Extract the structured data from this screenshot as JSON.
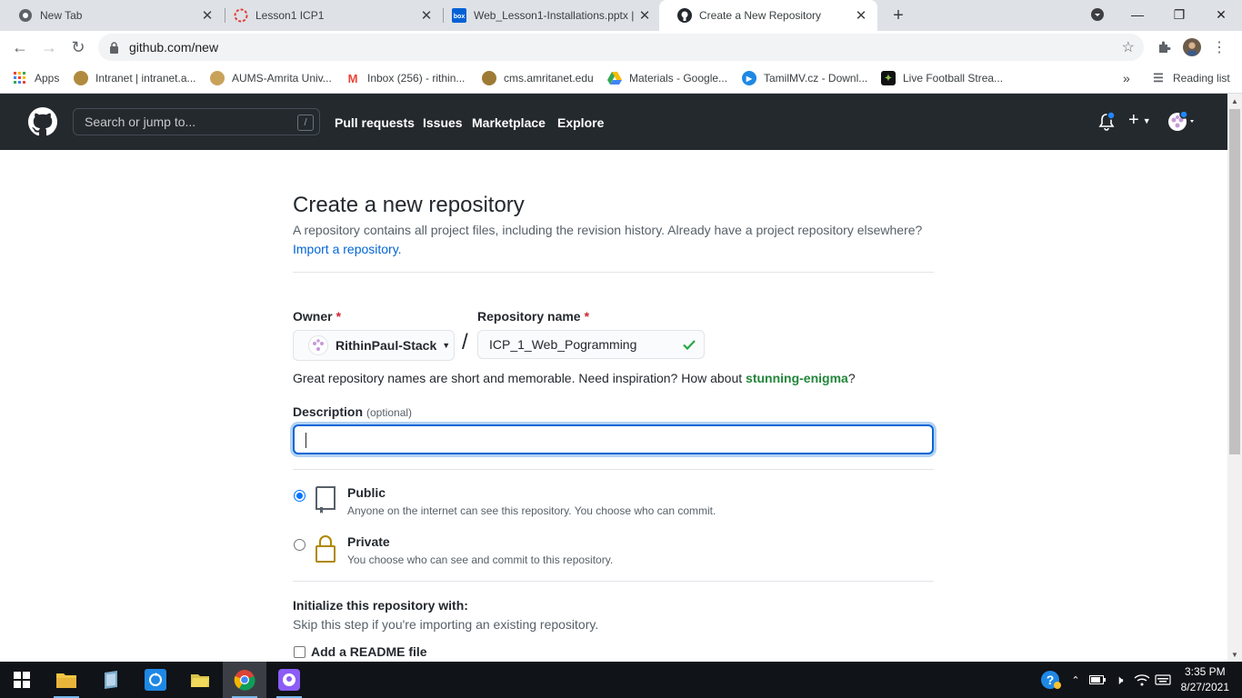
{
  "browser": {
    "tabs": [
      {
        "title": "New Tab",
        "icon": "chrome-icon"
      },
      {
        "title": "Lesson1 ICP1",
        "icon": "lesson-icon"
      },
      {
        "title": "Web_Lesson1-Installations.pptx |",
        "icon": "box-icon"
      },
      {
        "title": "Create a New Repository",
        "icon": "github-icon",
        "active": true
      }
    ],
    "url": "github.com/new",
    "bookmarks": [
      {
        "label": "Apps"
      },
      {
        "label": "Intranet | intranet.a..."
      },
      {
        "label": "AUMS-Amrita Univ..."
      },
      {
        "label": "Inbox (256) - rithin..."
      },
      {
        "label": "cms.amritanet.edu"
      },
      {
        "label": "Materials - Google..."
      },
      {
        "label": "TamilMV.cz - Downl..."
      },
      {
        "label": "Live Football Strea..."
      }
    ],
    "reading_list": "Reading list",
    "more_bookmarks": "»"
  },
  "github": {
    "search_placeholder": "Search or jump to...",
    "search_key": "/",
    "nav": [
      "Pull requests",
      "Issues",
      "Marketplace",
      "Explore"
    ],
    "plus": "+"
  },
  "page": {
    "title": "Create a new repository",
    "subhead_text": "A repository contains all project files, including the revision history. Already have a project repository elsewhere?",
    "import_link": "Import a repository.",
    "owner_label": "Owner",
    "required_mark": "*",
    "owner_value": "RithinPaul-Stack",
    "separator": "/",
    "repo_name_label": "Repository name",
    "repo_name_value": "ICP_1_Web_Pogramming",
    "hint_prefix": "Great repository names are short and memorable. Need inspiration? How about ",
    "hint_suggestion": "stunning-enigma",
    "hint_suffix": "?",
    "description_label": "Description",
    "description_optional": "(optional)",
    "description_value": "",
    "visibility": [
      {
        "title": "Public",
        "desc": "Anyone on the internet can see this repository. You choose who can commit.",
        "checked": true
      },
      {
        "title": "Private",
        "desc": "You choose who can see and commit to this repository.",
        "checked": false
      }
    ],
    "init_title": "Initialize this repository with:",
    "init_sub": "Skip this step if you're importing an existing repository.",
    "readme_label": "Add a README file"
  },
  "taskbar": {
    "time": "3:35 PM",
    "date": "8/27/2021"
  },
  "colors": {
    "github_header": "#24292e",
    "link_blue": "#0366d6",
    "suggestion_green": "#22863a",
    "required_red": "#cb2431"
  }
}
